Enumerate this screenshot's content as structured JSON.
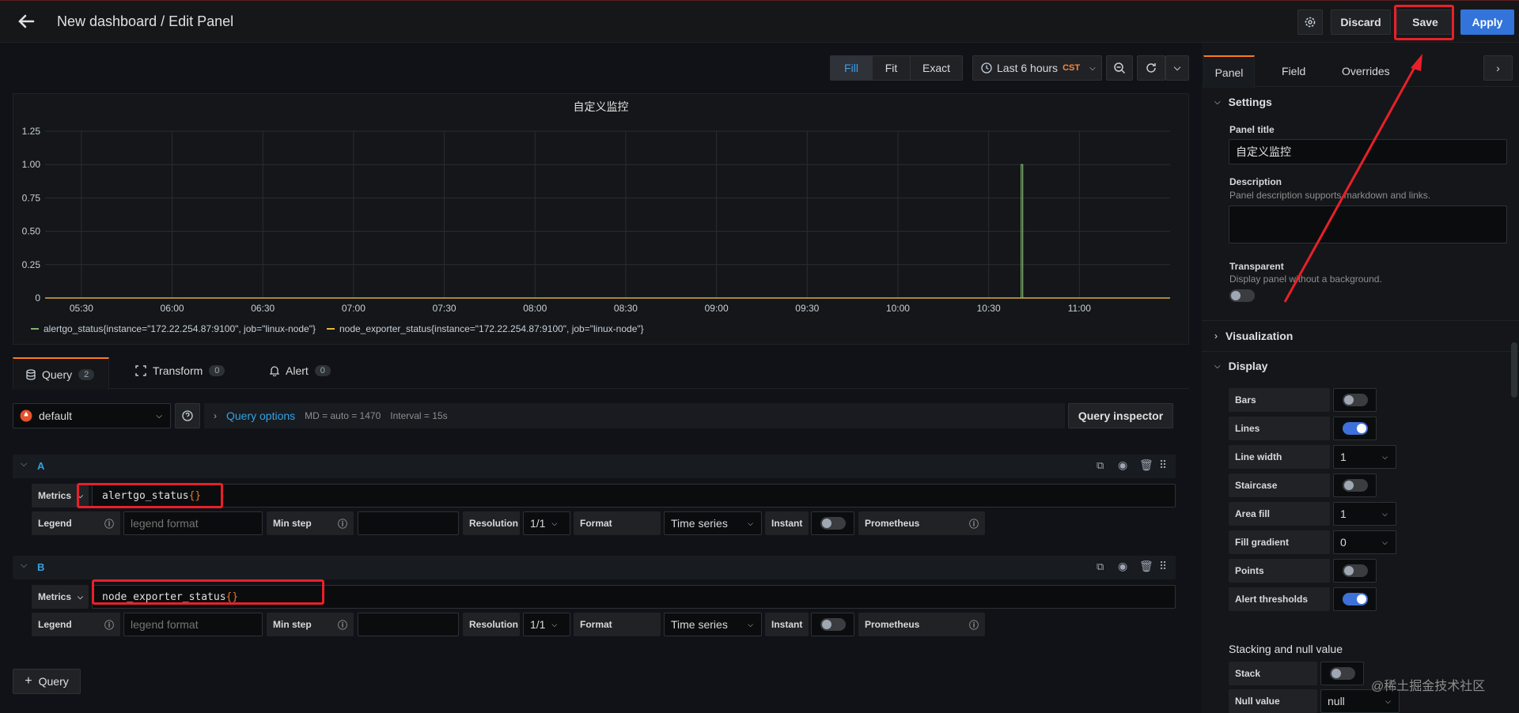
{
  "header": {
    "title": "New dashboard / Edit Panel",
    "discard_label": "Discard",
    "save_label": "Save",
    "apply_label": "Apply"
  },
  "toolbar": {
    "fill_label": "Fill",
    "fit_label": "Fit",
    "exact_label": "Exact",
    "time_range": "Last 6 hours",
    "timezone": "CST"
  },
  "chart_data": {
    "type": "line",
    "title": "自定义监控",
    "x": [
      "05:30",
      "06:00",
      "06:30",
      "07:00",
      "07:30",
      "08:00",
      "08:30",
      "09:00",
      "09:30",
      "10:00",
      "10:30",
      "11:00"
    ],
    "yticks": [
      "1.25",
      "1.00",
      "0.75",
      "0.50",
      "0.25",
      "0"
    ],
    "ylim": [
      0,
      1.25
    ],
    "grid": true,
    "legend_position": "bottom",
    "series": [
      {
        "name": "alertgo_status{instance=\"172.22.254.87:9100\", job=\"linux-node\"}",
        "color": "#7eb26d",
        "values": [
          0,
          0,
          0,
          0,
          0,
          0,
          0,
          0,
          0,
          0,
          0,
          0
        ],
        "spike": {
          "x": "10:41",
          "value": 1
        }
      },
      {
        "name": "node_exporter_status{instance=\"172.22.254.87:9100\", job=\"linux-node\"}",
        "color": "#eab839",
        "values": [
          0,
          0,
          0,
          0,
          0,
          0,
          0,
          0,
          0,
          0,
          0,
          0
        ]
      }
    ]
  },
  "tabs": {
    "query_label": "Query",
    "query_count": "2",
    "transform_label": "Transform",
    "transform_count": "0",
    "alert_label": "Alert",
    "alert_count": "0"
  },
  "datasource": {
    "name": "default",
    "query_options_label": "Query options",
    "md": "MD = auto = 1470",
    "interval": "Interval = 15s",
    "inspector_label": "Query inspector"
  },
  "queries": [
    {
      "ref": "A",
      "metrics_label": "Metrics",
      "expr_name": "alertgo_status",
      "expr_braces": "{}",
      "legend_label": "Legend",
      "legend_placeholder": "legend format",
      "minstep_label": "Min step",
      "resolution_label": "Resolution",
      "resolution_value": "1/1",
      "format_label": "Format",
      "format_value": "Time series",
      "instant_label": "Instant",
      "prometheus_label": "Prometheus"
    },
    {
      "ref": "B",
      "metrics_label": "Metrics",
      "expr_name": "node_exporter_status",
      "expr_braces": "{}",
      "legend_label": "Legend",
      "legend_placeholder": "legend format",
      "minstep_label": "Min step",
      "resolution_label": "Resolution",
      "resolution_value": "1/1",
      "format_label": "Format",
      "format_value": "Time series",
      "instant_label": "Instant",
      "prometheus_label": "Prometheus"
    }
  ],
  "add_query_label": "Query",
  "sidepanel": {
    "tabs": [
      "Panel",
      "Field",
      "Overrides"
    ],
    "settings_label": "Settings",
    "panel_title_label": "Panel title",
    "panel_title_value": "自定义监控",
    "description_label": "Description",
    "description_hint": "Panel description supports markdown and links.",
    "transparent_label": "Transparent",
    "transparent_hint": "Display panel without a background.",
    "visualization_label": "Visualization",
    "display_label": "Display",
    "display_rows": [
      {
        "label": "Bars",
        "type": "toggle",
        "on": false
      },
      {
        "label": "Lines",
        "type": "toggle",
        "on": true
      },
      {
        "label": "Line width",
        "type": "select",
        "value": "1"
      },
      {
        "label": "Staircase",
        "type": "toggle",
        "on": false
      },
      {
        "label": "Area fill",
        "type": "select",
        "value": "1"
      },
      {
        "label": "Fill gradient",
        "type": "select",
        "value": "0"
      },
      {
        "label": "Points",
        "type": "toggle",
        "on": false
      },
      {
        "label": "Alert thresholds",
        "type": "toggle",
        "on": true
      }
    ],
    "stacking_label": "Stacking and null value",
    "stack_label": "Stack",
    "null_value_label": "Null value",
    "null_value_value": "null"
  },
  "watermark": "@稀土掘金技术社区"
}
